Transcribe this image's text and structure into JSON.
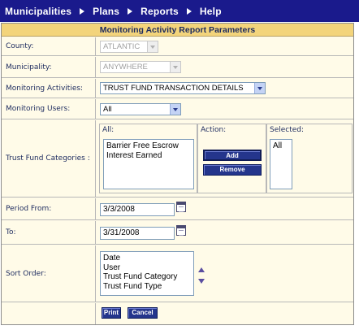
{
  "menu": {
    "items": [
      {
        "label": "Municipalities"
      },
      {
        "label": "Plans"
      },
      {
        "label": "Reports"
      },
      {
        "label": "Help"
      }
    ]
  },
  "form": {
    "title": "Monitoring Activity Report Parameters",
    "county": {
      "label": "County:",
      "value": "ATLANTIC"
    },
    "municipality": {
      "label": "Municipality:",
      "value": "ANYWHERE"
    },
    "activities": {
      "label": "Monitoring Activities:",
      "value": "TRUST FUND TRANSACTION DETAILS"
    },
    "users": {
      "label": "Monitoring Users:",
      "value": "All"
    },
    "trust_fund": {
      "label": "Trust Fund Categories :",
      "all_header": "All:",
      "action_header": "Action:",
      "selected_header": "Selected:",
      "available": [
        "Barrier Free Escrow",
        "Interest Earned"
      ],
      "selected": [
        "All"
      ],
      "add_label": "Add",
      "remove_label": "Remove"
    },
    "period_from": {
      "label": "Period From:",
      "value": "3/3/2008"
    },
    "period_to": {
      "label": "To:",
      "value": "3/31/2008"
    },
    "sort_order": {
      "label": "Sort Order:",
      "options": [
        "Date",
        "User",
        "Trust Fund Category",
        "Trust Fund Type"
      ]
    },
    "print_label": "Print",
    "cancel_label": "Cancel"
  },
  "colors": {
    "menu_bg": "#1a1a8c",
    "header_bg": "#f3d47b",
    "form_bg": "#fffbe8",
    "button_bg": "#24358c"
  }
}
